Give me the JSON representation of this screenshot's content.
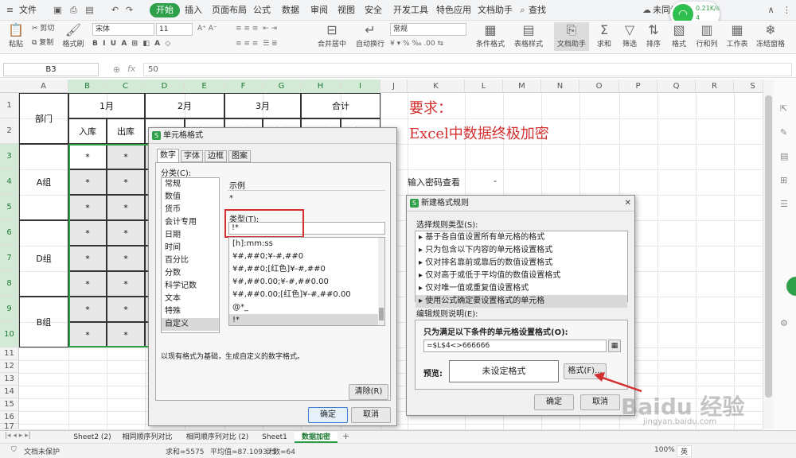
{
  "titlebar": {
    "file_menu": "文件",
    "tabs": [
      "开始",
      "插入",
      "页面布局",
      "公式",
      "数据",
      "审阅",
      "视图",
      "安全",
      "开发工具",
      "特色应用",
      "文档助手"
    ],
    "active_tab": "开始",
    "search": "查找",
    "sync": "未同步",
    "net_speed": "0.21K/s",
    "net_count": "4"
  },
  "ribbon": {
    "paste": "粘贴",
    "cut": "剪切",
    "copy": "复制",
    "format_painter": "格式刷",
    "font_name": "宋体",
    "font_size": "11",
    "merge_center": "合并居中",
    "wrap_text": "自动换行",
    "number_format": "常规",
    "conditional_format": "条件格式",
    "table_style": "表格样式",
    "doc_assistant": "文档助手",
    "sum": "求和",
    "filter": "筛选",
    "sort": "排序",
    "format": "格式",
    "row_col": "行和列",
    "worksheet": "工作表",
    "freeze": "冻结窗格"
  },
  "formula_bar": {
    "name_box": "B3",
    "fx": "fx",
    "value": "50"
  },
  "columns": [
    "A",
    "B",
    "C",
    "D",
    "E",
    "F",
    "G",
    "H",
    "I",
    "J",
    "K",
    "L",
    "M",
    "N",
    "O",
    "P",
    "Q",
    "R",
    "S"
  ],
  "rows": [
    "1",
    "2",
    "3",
    "4",
    "5",
    "6",
    "7",
    "8",
    "9",
    "10",
    "11",
    "12",
    "13",
    "14",
    "15",
    "16",
    "17",
    "18",
    "19",
    "20"
  ],
  "table": {
    "dept_header": "部门",
    "months": [
      "1月",
      "2月",
      "3月",
      "合计"
    ],
    "in_label": "入库",
    "out_label": "出库",
    "groups": [
      "A组",
      "D组",
      "B组"
    ],
    "mask": "*"
  },
  "notes": {
    "req": "要求：",
    "title": "Excel中数据终极加密",
    "pwd_label": "输入密码查看",
    "pwd_value": "-"
  },
  "format_dialog": {
    "title": "单元格格式",
    "tabs": [
      "数字",
      "字体",
      "边框",
      "图案"
    ],
    "category_label": "分类(C):",
    "categories": [
      "常规",
      "数值",
      "货币",
      "会计专用",
      "日期",
      "时间",
      "百分比",
      "分数",
      "科学记数",
      "文本",
      "特殊",
      "自定义"
    ],
    "selected_category": "自定义",
    "sample_label": "示例",
    "sample_value": "*",
    "type_label": "类型(T):",
    "type_value": "!*",
    "formats": [
      "[h]:mm:ss",
      "¥#,##0;¥-#,##0",
      "¥#,##0;[红色]¥-#,##0",
      "¥#,##0.00;¥-#,##0.00",
      "¥#,##0.00;[红色]¥-#,##0.00",
      "@*_",
      "!*"
    ],
    "hint": "以现有格式为基础，生成自定义的数字格式。",
    "delete": "清除(R)",
    "ok": "确定",
    "cancel": "取消"
  },
  "rule_dialog": {
    "title": "新建格式规则",
    "type_label": "选择规则类型(S):",
    "types": [
      "基于各自值设置所有单元格的格式",
      "只为包含以下内容的单元格设置格式",
      "仅对排名靠前或靠后的数值设置格式",
      "仅对高于或低于平均值的数值设置格式",
      "仅对唯一值或重复值设置格式",
      "使用公式确定要设置格式的单元格"
    ],
    "desc_label": "编辑规则说明(E):",
    "cond_label": "只为满足以下条件的单元格设置格式(O):",
    "formula": "=$L$4<>666666",
    "preview_label": "预览:",
    "preview_text": "未设定格式",
    "format_btn": "格式(F)...",
    "ok": "确定",
    "cancel": "取消"
  },
  "sheets": [
    "Sheet2 (2)",
    "相同顺序列对比",
    "相同顺序列对比 (2)",
    "Sheet1",
    "数据加密"
  ],
  "active_sheet": "数据加密",
  "status": {
    "protect": "文档未保护",
    "sum": "求和=5575",
    "avg": "平均值=87.109375",
    "count": "计数=64",
    "zoom": "100%",
    "ime": "英"
  },
  "watermark": {
    "main": "Baidu 经验",
    "sub": "jingyan.baidu.com"
  },
  "colors": {
    "accent": "#2fa04a",
    "red": "#d32f2f"
  }
}
